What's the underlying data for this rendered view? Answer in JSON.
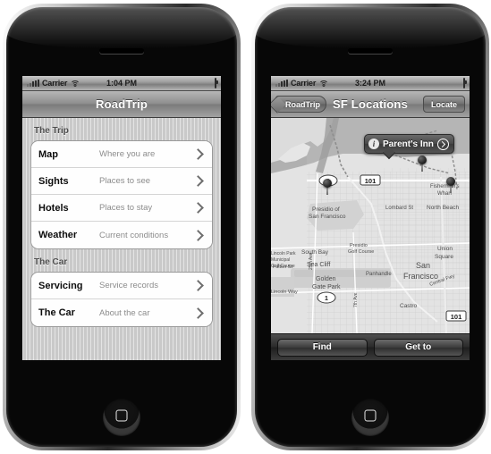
{
  "left_phone": {
    "status_bar": {
      "carrier": "Carrier",
      "time": "1:04 PM",
      "signal_icon": "signal-bars-icon",
      "wifi_icon": "wifi-icon",
      "battery_icon": "battery-icon"
    },
    "nav": {
      "title": "RoadTrip"
    },
    "sections": [
      {
        "header": "The Trip",
        "rows": [
          {
            "title": "Map",
            "detail": "Where you are"
          },
          {
            "title": "Sights",
            "detail": "Places to see"
          },
          {
            "title": "Hotels",
            "detail": "Places to stay"
          },
          {
            "title": "Weather",
            "detail": "Current conditions"
          }
        ]
      },
      {
        "header": "The Car",
        "rows": [
          {
            "title": "Servicing",
            "detail": "Service records"
          },
          {
            "title": "The Car",
            "detail": "About the car"
          }
        ]
      }
    ]
  },
  "right_phone": {
    "status_bar": {
      "carrier": "Carrier",
      "time": "3:24 PM",
      "signal_icon": "signal-bars-icon",
      "wifi_icon": "wifi-icon",
      "battery_icon": "battery-icon"
    },
    "nav": {
      "back_label": "RoadTrip",
      "title": "SF Locations",
      "right_button": "Locate"
    },
    "callout": {
      "info_icon": "info-icon",
      "label": "Parent's Inn",
      "disclosure_icon": "disclosure-arrow-icon"
    },
    "map_labels": [
      "Presidio of",
      "San Francisco",
      "Presidio",
      "Golf Course",
      "Lombard St",
      "North Beach",
      "Fisherman's",
      "Wharf",
      "Union",
      "Square",
      "South Bay",
      "Sea Cliff",
      "Golden",
      "Gate Park",
      "Panhandle",
      "Castro",
      "San",
      "Francisco",
      "Fulton St",
      "Lincoln Way",
      "25th Ave",
      "7th Ave",
      "Central Fwy",
      "Lincoln Park",
      "Municipal",
      "Golf Course"
    ],
    "map_shields": [
      "1",
      "101",
      "101",
      "1"
    ],
    "toolbar": {
      "find_label": "Find",
      "get_to_label": "Get to"
    }
  },
  "colors": {
    "screen_bg": "#c9c9c9",
    "row_bg": "#fefefe",
    "nav_bar": "#8e8e8e",
    "toolbar": "#2b2b2b",
    "callout": "#4a4a4a"
  }
}
